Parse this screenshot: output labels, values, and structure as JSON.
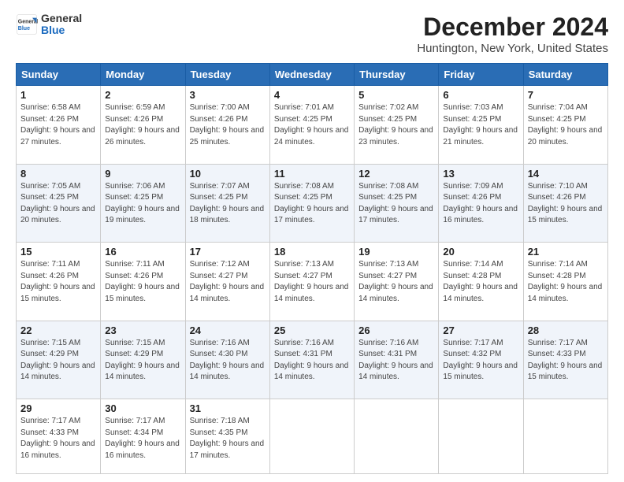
{
  "logo": {
    "general": "General",
    "blue": "Blue"
  },
  "title": "December 2024",
  "subtitle": "Huntington, New York, United States",
  "days_header": [
    "Sunday",
    "Monday",
    "Tuesday",
    "Wednesday",
    "Thursday",
    "Friday",
    "Saturday"
  ],
  "weeks": [
    [
      {
        "num": "1",
        "sunrise": "6:58 AM",
        "sunset": "4:26 PM",
        "daylight": "9 hours and 27 minutes."
      },
      {
        "num": "2",
        "sunrise": "6:59 AM",
        "sunset": "4:26 PM",
        "daylight": "9 hours and 26 minutes."
      },
      {
        "num": "3",
        "sunrise": "7:00 AM",
        "sunset": "4:26 PM",
        "daylight": "9 hours and 25 minutes."
      },
      {
        "num": "4",
        "sunrise": "7:01 AM",
        "sunset": "4:25 PM",
        "daylight": "9 hours and 24 minutes."
      },
      {
        "num": "5",
        "sunrise": "7:02 AM",
        "sunset": "4:25 PM",
        "daylight": "9 hours and 23 minutes."
      },
      {
        "num": "6",
        "sunrise": "7:03 AM",
        "sunset": "4:25 PM",
        "daylight": "9 hours and 21 minutes."
      },
      {
        "num": "7",
        "sunrise": "7:04 AM",
        "sunset": "4:25 PM",
        "daylight": "9 hours and 20 minutes."
      }
    ],
    [
      {
        "num": "8",
        "sunrise": "7:05 AM",
        "sunset": "4:25 PM",
        "daylight": "9 hours and 20 minutes."
      },
      {
        "num": "9",
        "sunrise": "7:06 AM",
        "sunset": "4:25 PM",
        "daylight": "9 hours and 19 minutes."
      },
      {
        "num": "10",
        "sunrise": "7:07 AM",
        "sunset": "4:25 PM",
        "daylight": "9 hours and 18 minutes."
      },
      {
        "num": "11",
        "sunrise": "7:08 AM",
        "sunset": "4:25 PM",
        "daylight": "9 hours and 17 minutes."
      },
      {
        "num": "12",
        "sunrise": "7:08 AM",
        "sunset": "4:25 PM",
        "daylight": "9 hours and 17 minutes."
      },
      {
        "num": "13",
        "sunrise": "7:09 AM",
        "sunset": "4:26 PM",
        "daylight": "9 hours and 16 minutes."
      },
      {
        "num": "14",
        "sunrise": "7:10 AM",
        "sunset": "4:26 PM",
        "daylight": "9 hours and 15 minutes."
      }
    ],
    [
      {
        "num": "15",
        "sunrise": "7:11 AM",
        "sunset": "4:26 PM",
        "daylight": "9 hours and 15 minutes."
      },
      {
        "num": "16",
        "sunrise": "7:11 AM",
        "sunset": "4:26 PM",
        "daylight": "9 hours and 15 minutes."
      },
      {
        "num": "17",
        "sunrise": "7:12 AM",
        "sunset": "4:27 PM",
        "daylight": "9 hours and 14 minutes."
      },
      {
        "num": "18",
        "sunrise": "7:13 AM",
        "sunset": "4:27 PM",
        "daylight": "9 hours and 14 minutes."
      },
      {
        "num": "19",
        "sunrise": "7:13 AM",
        "sunset": "4:27 PM",
        "daylight": "9 hours and 14 minutes."
      },
      {
        "num": "20",
        "sunrise": "7:14 AM",
        "sunset": "4:28 PM",
        "daylight": "9 hours and 14 minutes."
      },
      {
        "num": "21",
        "sunrise": "7:14 AM",
        "sunset": "4:28 PM",
        "daylight": "9 hours and 14 minutes."
      }
    ],
    [
      {
        "num": "22",
        "sunrise": "7:15 AM",
        "sunset": "4:29 PM",
        "daylight": "9 hours and 14 minutes."
      },
      {
        "num": "23",
        "sunrise": "7:15 AM",
        "sunset": "4:29 PM",
        "daylight": "9 hours and 14 minutes."
      },
      {
        "num": "24",
        "sunrise": "7:16 AM",
        "sunset": "4:30 PM",
        "daylight": "9 hours and 14 minutes."
      },
      {
        "num": "25",
        "sunrise": "7:16 AM",
        "sunset": "4:31 PM",
        "daylight": "9 hours and 14 minutes."
      },
      {
        "num": "26",
        "sunrise": "7:16 AM",
        "sunset": "4:31 PM",
        "daylight": "9 hours and 14 minutes."
      },
      {
        "num": "27",
        "sunrise": "7:17 AM",
        "sunset": "4:32 PM",
        "daylight": "9 hours and 15 minutes."
      },
      {
        "num": "28",
        "sunrise": "7:17 AM",
        "sunset": "4:33 PM",
        "daylight": "9 hours and 15 minutes."
      }
    ],
    [
      {
        "num": "29",
        "sunrise": "7:17 AM",
        "sunset": "4:33 PM",
        "daylight": "9 hours and 16 minutes."
      },
      {
        "num": "30",
        "sunrise": "7:17 AM",
        "sunset": "4:34 PM",
        "daylight": "9 hours and 16 minutes."
      },
      {
        "num": "31",
        "sunrise": "7:18 AM",
        "sunset": "4:35 PM",
        "daylight": "9 hours and 17 minutes."
      },
      null,
      null,
      null,
      null
    ]
  ],
  "labels": {
    "sunrise": "Sunrise:",
    "sunset": "Sunset:",
    "daylight": "Daylight:"
  }
}
